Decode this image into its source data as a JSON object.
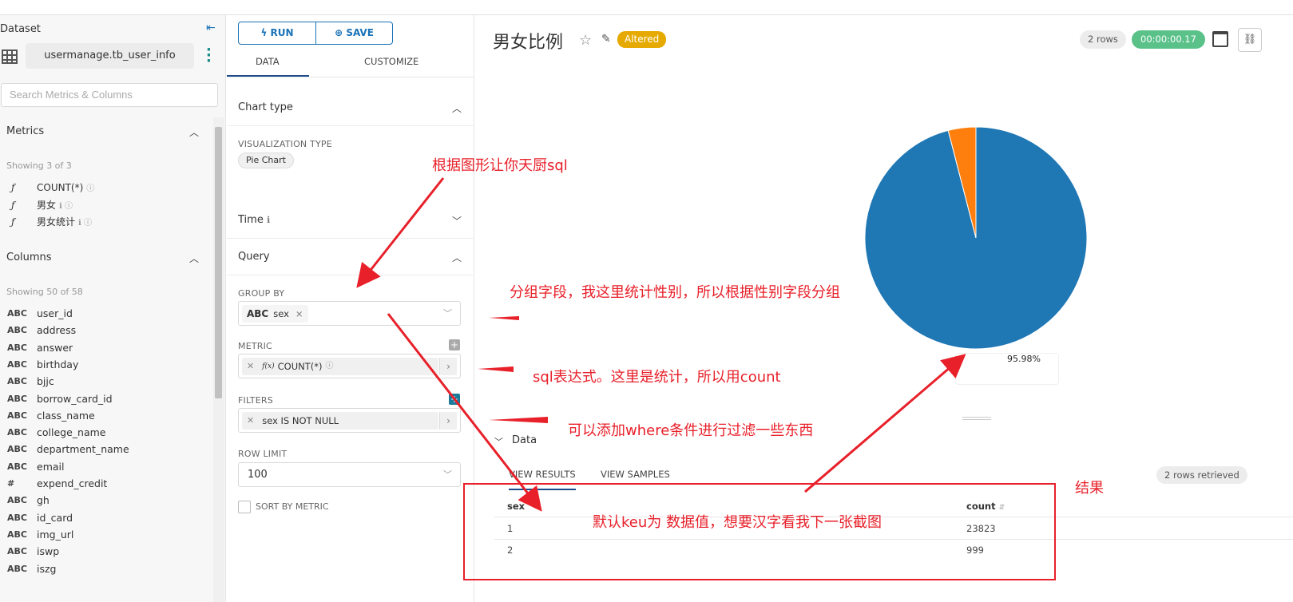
{
  "dataset": {
    "label": "Dataset",
    "name": "usermanage.tb_user_info",
    "search_placeholder": "Search Metrics & Columns",
    "metrics_heading": "Metrics",
    "metrics_showing": "Showing 3 of 3",
    "metrics": [
      {
        "type": "ƒ",
        "name": "COUNT(*)",
        "info": false
      },
      {
        "type": "ƒ",
        "name": "男女",
        "info": true
      },
      {
        "type": "ƒ",
        "name": "男女统计",
        "info": true
      }
    ],
    "columns_heading": "Columns",
    "columns_showing": "Showing 50 of 58",
    "columns": [
      {
        "type": "ABC",
        "name": "user_id"
      },
      {
        "type": "ABC",
        "name": "address"
      },
      {
        "type": "ABC",
        "name": "answer"
      },
      {
        "type": "ABC",
        "name": "birthday"
      },
      {
        "type": "ABC",
        "name": "bjjc"
      },
      {
        "type": "ABC",
        "name": "borrow_card_id"
      },
      {
        "type": "ABC",
        "name": "class_name"
      },
      {
        "type": "ABC",
        "name": "college_name"
      },
      {
        "type": "ABC",
        "name": "department_name"
      },
      {
        "type": "ABC",
        "name": "email"
      },
      {
        "type": "#",
        "name": "expend_credit"
      },
      {
        "type": "ABC",
        "name": "gh"
      },
      {
        "type": "ABC",
        "name": "id_card"
      },
      {
        "type": "ABC",
        "name": "img_url"
      },
      {
        "type": "ABC",
        "name": "iswp"
      },
      {
        "type": "ABC",
        "name": "iszg"
      }
    ]
  },
  "controls": {
    "run_label": "RUN",
    "save_label": "SAVE",
    "tab_data": "DATA",
    "tab_customize": "CUSTOMIZE",
    "chart_type_heading": "Chart type",
    "viz_type_label": "VISUALIZATION TYPE",
    "viz_type_value": "Pie Chart",
    "time_heading": "Time",
    "query_heading": "Query",
    "group_by_label": "GROUP BY",
    "group_by_type": "ABC",
    "group_by_value": "sex",
    "metric_label": "METRIC",
    "metric_value": "COUNT(*)",
    "filters_label": "FILTERS",
    "filter_value": "sex IS NOT NULL",
    "row_limit_label": "ROW LIMIT",
    "row_limit_value": "100",
    "sort_by_metric_label": "SORT BY METRIC"
  },
  "chart": {
    "title": "男女比例",
    "altered_badge": "Altered",
    "rows_badge": "2 rows",
    "timer": "00:00:00.17",
    "pct_label": "95.98%",
    "colors": {
      "slice_1": "#1f77b4",
      "slice_2": "#ff7f0e"
    }
  },
  "chart_data": {
    "type": "pie",
    "categories": [
      "1",
      "2"
    ],
    "values": [
      23823,
      999
    ],
    "labels": [
      "95.98%"
    ]
  },
  "results": {
    "heading": "Data",
    "tab_results": "VIEW RESULTS",
    "tab_samples": "VIEW SAMPLES",
    "retrieved": "2 rows retrieved",
    "columns": [
      "sex",
      "count"
    ],
    "rows": [
      [
        "1",
        "23823"
      ],
      [
        "2",
        "999"
      ]
    ]
  },
  "annotations": {
    "a1": "根据图形让你天厨sql",
    "a2": "分组字段，我这里统计性别，所以根据性别字段分组",
    "a3": "sql表达式。这里是统计，所以用count",
    "a4": "可以添加where条件进行过滤一些东西",
    "a5": "默认keu为 数据值，想要汉字看我下一张截图",
    "a6": "结果"
  }
}
